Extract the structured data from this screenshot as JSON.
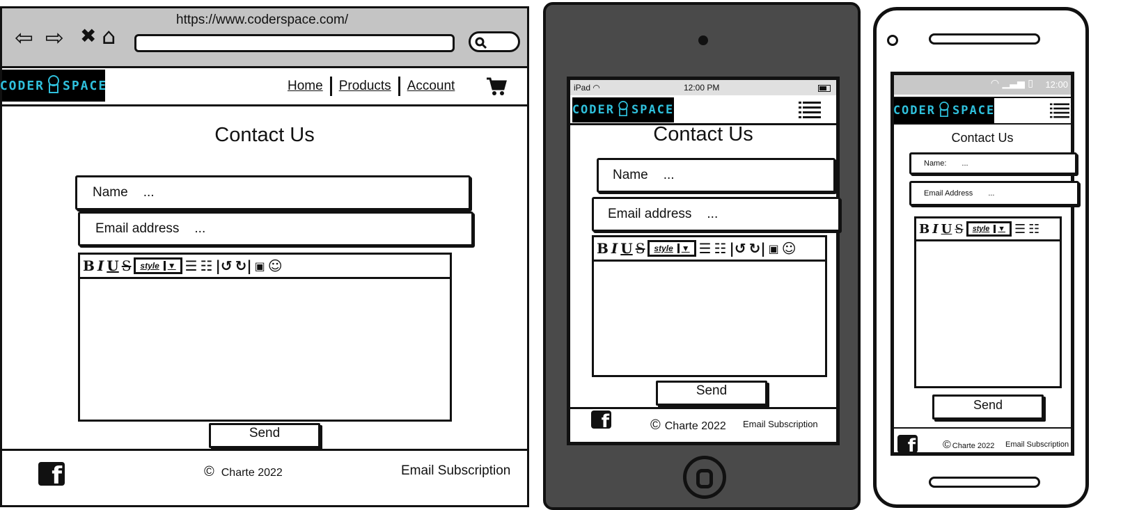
{
  "desktop": {
    "url": "https://www.coderspace.com/",
    "logo": {
      "text_left": "CODER",
      "text_right": "SPACE"
    },
    "nav": [
      "Home",
      "Products",
      "Account"
    ],
    "title": "Contact Us",
    "form": {
      "name_label": "Name",
      "name_placeholder": "...",
      "email_label": "Email address",
      "email_placeholder": "..."
    },
    "toolbar": {
      "bold": "B",
      "italic": "I",
      "underline": "U",
      "strike": "S",
      "style": "style"
    },
    "send_label": "Send",
    "footer": {
      "copyright": "Charte 2022",
      "email_subscription": "Email Subscription"
    }
  },
  "tablet": {
    "status": {
      "device": "iPad",
      "time": "12:00 PM"
    },
    "logo": {
      "text_left": "CODER",
      "text_right": "SPACE"
    },
    "title": "Contact Us",
    "form": {
      "name_label": "Name",
      "name_placeholder": "...",
      "email_label": "Email address",
      "email_placeholder": "..."
    },
    "toolbar": {
      "bold": "B",
      "italic": "I",
      "underline": "U",
      "strike": "S",
      "style": "style"
    },
    "send_label": "Send",
    "footer": {
      "copyright": "Charte 2022",
      "email_subscription": "Email Subscription"
    }
  },
  "phone": {
    "status": {
      "time": "12:00"
    },
    "logo": {
      "text_left": "CODER",
      "text_right": "SPACE"
    },
    "title": "Contact Us",
    "form": {
      "name_label": "Name:",
      "name_placeholder": "...",
      "email_label": "Email Address",
      "email_placeholder": "..."
    },
    "toolbar": {
      "bold": "B",
      "italic": "I",
      "underline": "U",
      "strike": "S",
      "style": "style"
    },
    "send_label": "Send",
    "footer": {
      "copyright": "Charte 2022",
      "email_subscription": "Email Subscription"
    }
  },
  "colors": {
    "logo_bg": "#000000",
    "logo_text": "#2fc0dc",
    "browser_chrome": "#c4c4c4",
    "tablet_body": "#4a4a4a"
  },
  "icons": [
    "back-arrow-icon",
    "forward-arrow-icon",
    "close-icon",
    "home-icon",
    "search-icon",
    "cart-icon",
    "hamburger-menu-icon",
    "facebook-icon",
    "copyright-icon",
    "wifi-icon",
    "battery-icon",
    "image-icon",
    "emoji-icon"
  ]
}
